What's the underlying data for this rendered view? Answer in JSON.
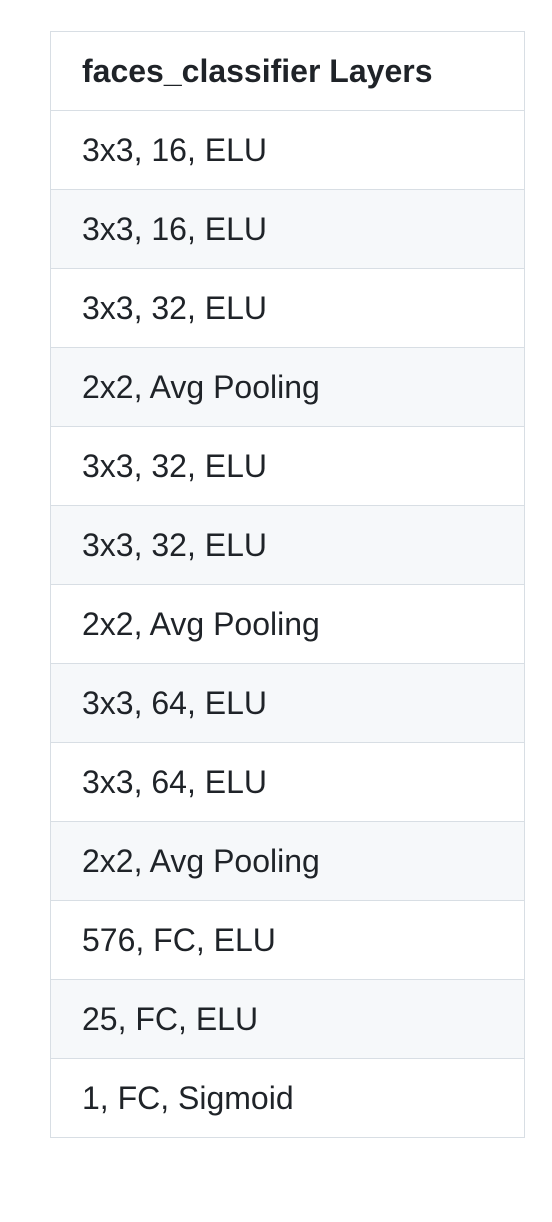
{
  "table": {
    "header": "faces_classifier Layers",
    "rows": [
      "3x3, 16, ELU",
      "3x3, 16, ELU",
      "3x3, 32, ELU",
      "2x2, Avg Pooling",
      "3x3, 32, ELU",
      "3x3, 32, ELU",
      "2x2, Avg Pooling",
      "3x3, 64, ELU",
      "3x3, 64, ELU",
      "2x2, Avg Pooling",
      "576, FC, ELU",
      "25, FC, ELU",
      "1, FC, Sigmoid"
    ]
  },
  "colors": {
    "border": "#d8dee4",
    "stripe": "#f6f8fa",
    "text": "#1f2328"
  }
}
